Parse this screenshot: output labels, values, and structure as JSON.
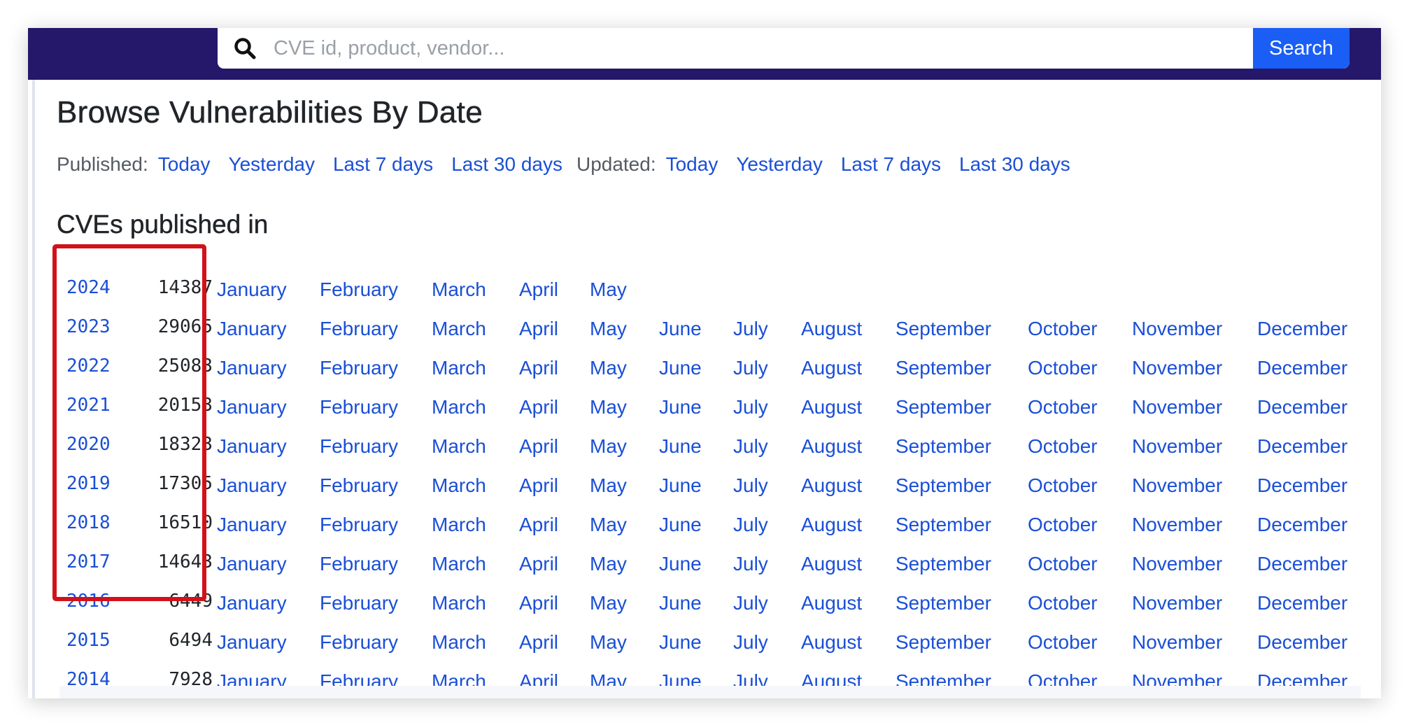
{
  "search": {
    "placeholder": "CVE id, product, vendor...",
    "button_label": "Search"
  },
  "page": {
    "title": "Browse Vulnerabilities By Date",
    "section_title": "CVEs published in"
  },
  "filters": {
    "published_label": "Published:",
    "published_links": [
      "Today",
      "Yesterday",
      "Last 7 days",
      "Last 30 days"
    ],
    "updated_label": "Updated:",
    "updated_links": [
      "Today",
      "Yesterday",
      "Last 7 days",
      "Last 30 days"
    ]
  },
  "months": [
    "January",
    "February",
    "March",
    "April",
    "May",
    "June",
    "July",
    "August",
    "September",
    "October",
    "November",
    "December"
  ],
  "years": [
    {
      "year": "2024",
      "count": "14387",
      "months_shown": 5
    },
    {
      "year": "2023",
      "count": "29065",
      "months_shown": 12
    },
    {
      "year": "2022",
      "count": "25083",
      "months_shown": 12
    },
    {
      "year": "2021",
      "count": "20153",
      "months_shown": 12
    },
    {
      "year": "2020",
      "count": "18323",
      "months_shown": 12
    },
    {
      "year": "2019",
      "count": "17305",
      "months_shown": 12
    },
    {
      "year": "2018",
      "count": "16510",
      "months_shown": 12
    },
    {
      "year": "2017",
      "count": "14643",
      "months_shown": 12
    },
    {
      "year": "2016",
      "count": "6449",
      "months_shown": 12
    },
    {
      "year": "2015",
      "count": "6494",
      "months_shown": 12
    },
    {
      "year": "2014",
      "count": "7928",
      "months_shown": 12
    }
  ],
  "colors": {
    "header_bg": "#25176a",
    "search_button": "#1a5ef5",
    "link": "#1a4fd6",
    "highlight_box": "#d3111a"
  },
  "icons": {
    "search": "magnifying-glass"
  }
}
